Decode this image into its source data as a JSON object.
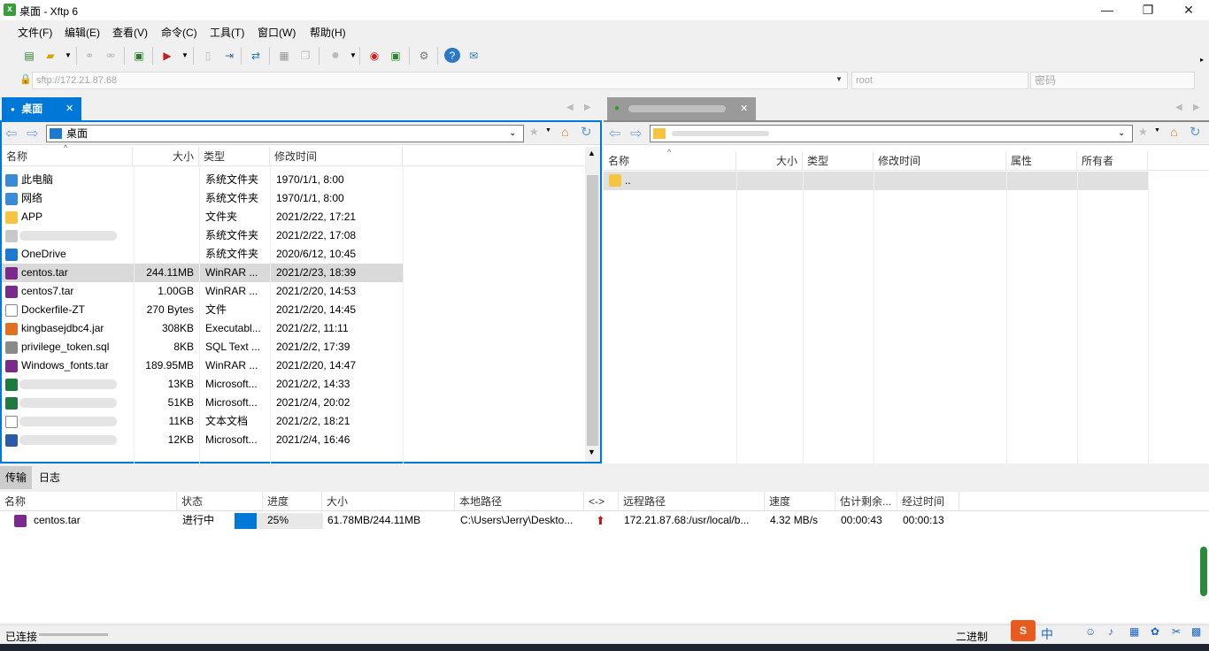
{
  "window": {
    "title": "桌面 - Xftp 6",
    "minimize": "—",
    "maximize": "❐",
    "close": "✕"
  },
  "menu": [
    "文件(F)",
    "编辑(E)",
    "查看(V)",
    "命令(C)",
    "工具(T)",
    "窗口(W)",
    "帮助(H)"
  ],
  "address": {
    "host": "sftp://172.21.87.68",
    "user": "root",
    "password_placeholder": "密码"
  },
  "left_pane": {
    "tab_label": "桌面",
    "path": "桌面",
    "columns": [
      "名称",
      "大小",
      "类型",
      "修改时间"
    ],
    "rows": [
      {
        "name": "此电脑",
        "size": "",
        "type": "系统文件夹",
        "mtime": "1970/1/1, 8:00",
        "icon": "computer-icon"
      },
      {
        "name": "网络",
        "size": "",
        "type": "系统文件夹",
        "mtime": "1970/1/1, 8:00",
        "icon": "network-icon"
      },
      {
        "name": "APP",
        "size": "",
        "type": "文件夹",
        "mtime": "2021/2/22, 17:21",
        "icon": "folder-icon"
      },
      {
        "name": "",
        "size": "",
        "type": "系统文件夹",
        "mtime": "2021/2/22, 17:08",
        "icon": "user-folder-icon"
      },
      {
        "name": "OneDrive",
        "size": "",
        "type": "系统文件夹",
        "mtime": "2020/6/12, 10:45",
        "icon": "cloud-icon"
      },
      {
        "name": "centos.tar",
        "size": "244.11MB",
        "type": "WinRAR ...",
        "mtime": "2021/2/23, 18:39",
        "icon": "winrar-icon",
        "selected": true
      },
      {
        "name": "centos7.tar",
        "size": "1.00GB",
        "type": "WinRAR ...",
        "mtime": "2021/2/20, 14:53",
        "icon": "winrar-icon"
      },
      {
        "name": "Dockerfile-ZT",
        "size": "270 Bytes",
        "type": "文件",
        "mtime": "2021/2/20, 14:45",
        "icon": "file-icon"
      },
      {
        "name": "kingbasejdbc4.jar",
        "size": "308KB",
        "type": "Executabl...",
        "mtime": "2021/2/2, 11:11",
        "icon": "jar-icon"
      },
      {
        "name": "privilege_token.sql",
        "size": "8KB",
        "type": "SQL Text ...",
        "mtime": "2021/2/2, 17:39",
        "icon": "sql-icon"
      },
      {
        "name": "Windows_fonts.tar",
        "size": "189.95MB",
        "type": "WinRAR ...",
        "mtime": "2021/2/20, 14:47",
        "icon": "winrar-icon"
      },
      {
        "name": "",
        "size": "13KB",
        "type": "Microsoft...",
        "mtime": "2021/2/2, 14:33",
        "icon": "excel-icon"
      },
      {
        "name": "",
        "size": "51KB",
        "type": "Microsoft...",
        "mtime": "2021/2/4, 20:02",
        "icon": "excel-icon"
      },
      {
        "name": "",
        "size": "11KB",
        "type": "文本文档",
        "mtime": "2021/2/2, 18:21",
        "icon": "text-icon"
      },
      {
        "name": "",
        "size": "12KB",
        "type": "Microsoft...",
        "mtime": "2021/2/4, 16:46",
        "icon": "word-icon"
      }
    ]
  },
  "right_pane": {
    "columns": [
      "名称",
      "大小",
      "类型",
      "修改时间",
      "属性",
      "所有者"
    ],
    "rows": [
      {
        "name": ".."
      }
    ]
  },
  "bottom_tabs": [
    "传输",
    "日志"
  ],
  "transfer": {
    "columns": [
      "名称",
      "状态",
      "进度",
      "大小",
      "本地路径",
      "<->",
      "远程路径",
      "速度",
      "估计剩余...",
      "经过时间"
    ],
    "rows": [
      {
        "name": "centos.tar",
        "status": "进行中",
        "progress": 0.25,
        "progress_text": "25%",
        "size": "61.78MB/244.11MB",
        "local": "C:\\Users\\Jerry\\Deskto...",
        "remote": "172.21.87.68:/usr/local/b...",
        "speed": "4.32 MB/s",
        "remaining": "00:00:43",
        "elapsed": "00:00:13"
      }
    ]
  },
  "status": {
    "left": "已连接",
    "mode": "二进制"
  },
  "colors": {
    "accent": "#0078d7",
    "selection": "#d9d9d9",
    "progress": "#0078d7"
  }
}
